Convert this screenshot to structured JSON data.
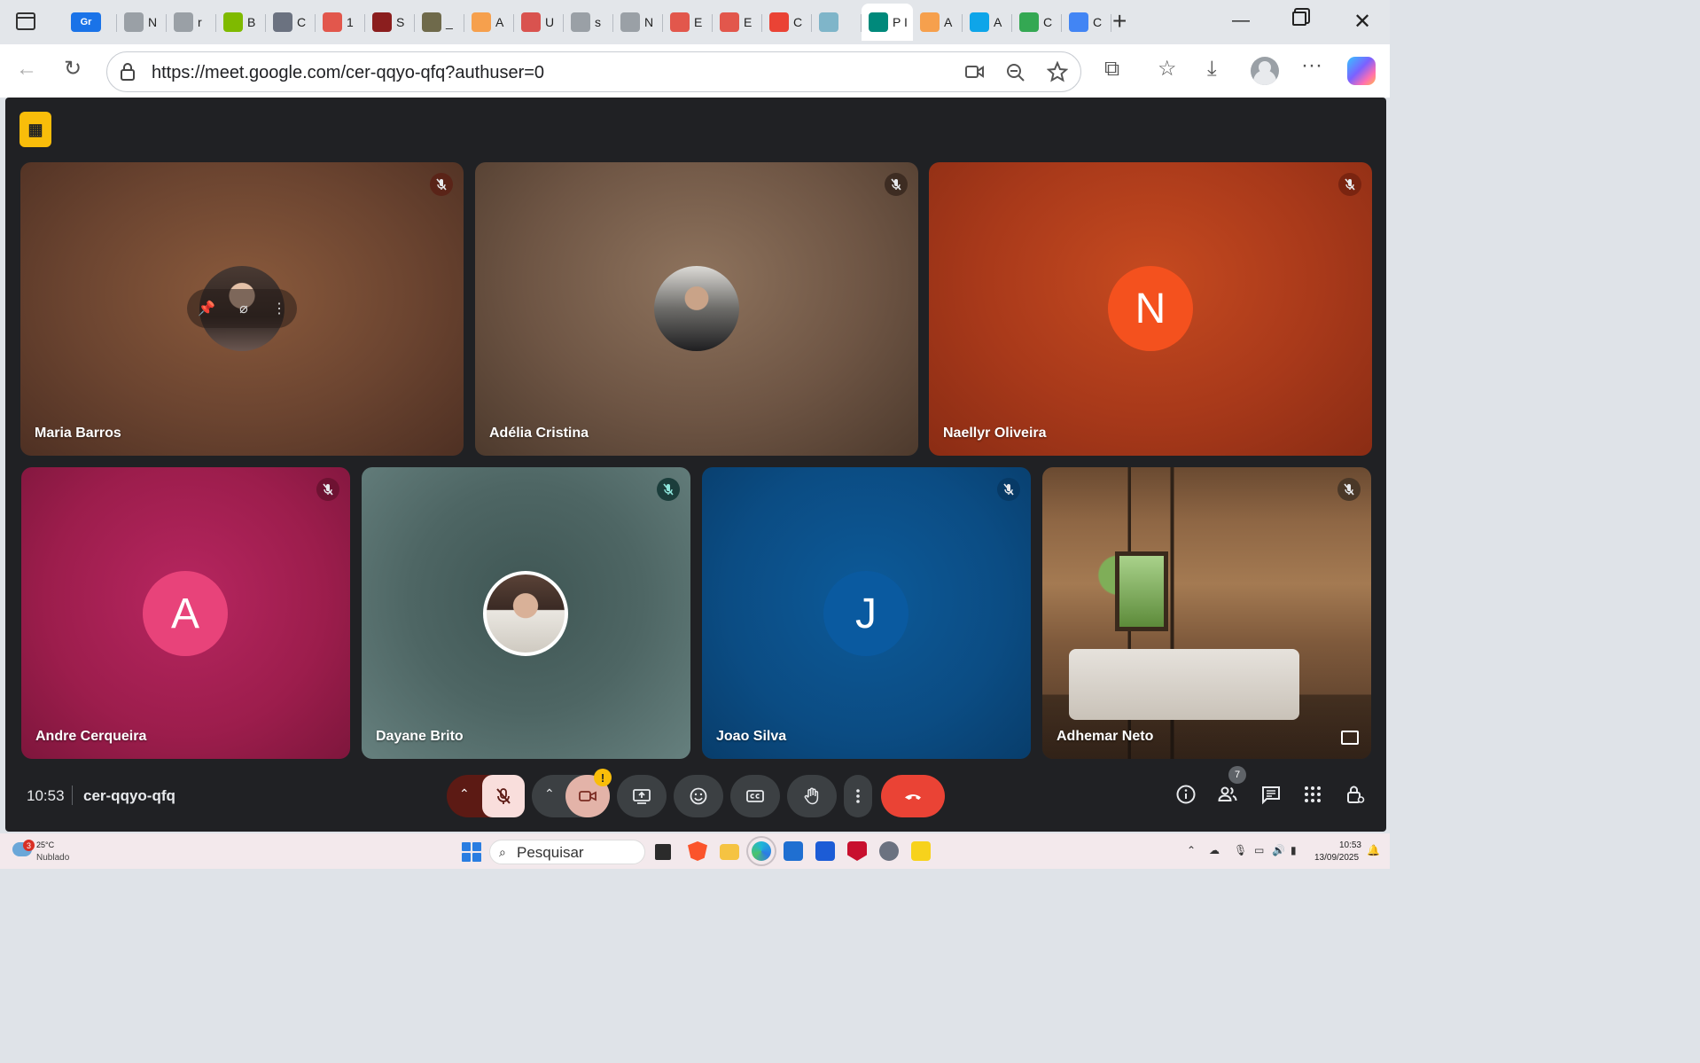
{
  "tabs": [
    {
      "icon": "grammarly-icon",
      "label": "Gr",
      "color": "#1a73e8"
    },
    {
      "icon": "page-icon",
      "label": "N"
    },
    {
      "icon": "doc-blocked-icon",
      "label": "r"
    },
    {
      "icon": "microsoft-icon",
      "label": "B"
    },
    {
      "icon": "openai-icon",
      "label": "C"
    },
    {
      "icon": "pdf-icon",
      "label": "1"
    },
    {
      "icon": "crest-icon",
      "label": "S"
    },
    {
      "icon": "site-thumb-icon",
      "label": "_"
    },
    {
      "icon": "copilot-infinity-icon",
      "label": "A"
    },
    {
      "icon": "calendar-icon",
      "label": "U"
    },
    {
      "icon": "doc-blocked-icon",
      "label": "s"
    },
    {
      "icon": "page-icon",
      "label": "N"
    },
    {
      "icon": "pdf-icon",
      "label": "E"
    },
    {
      "icon": "pdf-icon",
      "label": "E"
    },
    {
      "icon": "gmail-icon",
      "label": "C"
    },
    {
      "icon": "contact-icon",
      "label": ""
    },
    {
      "icon": "meet-icon",
      "label": "P I",
      "active": true
    },
    {
      "icon": "copilot-infinity-icon",
      "label": "A"
    },
    {
      "icon": "azure-icon",
      "label": "A"
    },
    {
      "icon": "drive-icon",
      "label": "C"
    },
    {
      "icon": "google-icon",
      "label": "C"
    }
  ],
  "address_bar": {
    "url": "https://meet.google.com/cer-qqyo-qfq?authuser=0"
  },
  "meet": {
    "clock": "10:53",
    "meeting_code": "cer-qqyo-qfq",
    "participants_count": "7",
    "participants": [
      {
        "name": "Maria Barros",
        "avatar": "photo",
        "muted": true,
        "bg": "#6b4430"
      },
      {
        "name": "Adélia Cristina",
        "avatar": "photo",
        "muted": true,
        "bg": "#6e5544"
      },
      {
        "name": "Naellyr Oliveira",
        "avatar_letter": "N",
        "muted": true,
        "bg": "#a8391a",
        "avatar_color": "#f4511e"
      },
      {
        "name": "Andre Cerqueira",
        "avatar_letter": "A",
        "muted": true,
        "bg": "#9c1d4c",
        "avatar_color": "#e8437a"
      },
      {
        "name": "Dayane Brito",
        "avatar": "photo",
        "muted": true,
        "bg": "#4e6664"
      },
      {
        "name": "Joao Silva",
        "avatar_letter": "J",
        "muted": true,
        "bg": "#0b4c83",
        "avatar_color": "#0a5aa0"
      },
      {
        "name": "Adhemar Neto",
        "avatar": "room-background",
        "muted": true,
        "bg": "#7a5638"
      }
    ]
  },
  "taskbar": {
    "weather_badge": "3",
    "temperature": "25°C",
    "weather": "Nublado",
    "search_placeholder": "Pesquisar",
    "time": "10:53",
    "date": "13/09/2025"
  }
}
